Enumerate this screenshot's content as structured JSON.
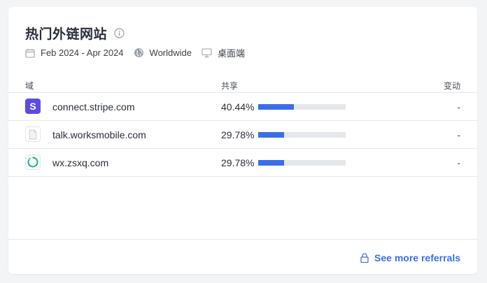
{
  "header": {
    "title": "热门外链网站",
    "info_icon": "info-circle-icon"
  },
  "meta": {
    "date_range": "Feb 2024 - Apr 2024",
    "region": "Worldwide",
    "device": "桌面端"
  },
  "table": {
    "columns": {
      "domain": "域",
      "share": "共享",
      "change": "变动"
    },
    "rows": [
      {
        "domain": "connect.stripe.com",
        "share_text": "40.44%",
        "share": 40.44,
        "change": "-",
        "icon": "stripe-icon"
      },
      {
        "domain": "talk.worksmobile.com",
        "share_text": "29.78%",
        "share": 29.78,
        "change": "-",
        "icon": "document-icon"
      },
      {
        "domain": "wx.zsxq.com",
        "share_text": "29.78%",
        "share": 29.78,
        "change": "-",
        "icon": "zsxq-icon"
      }
    ]
  },
  "footer": {
    "more_label": "See more referrals",
    "lock_icon": "lock-icon"
  },
  "colors": {
    "accent": "#3b6ee8",
    "bar_track": "#e4e7ec",
    "stripe": "#5b4de6",
    "zsxq": "#16b777"
  }
}
